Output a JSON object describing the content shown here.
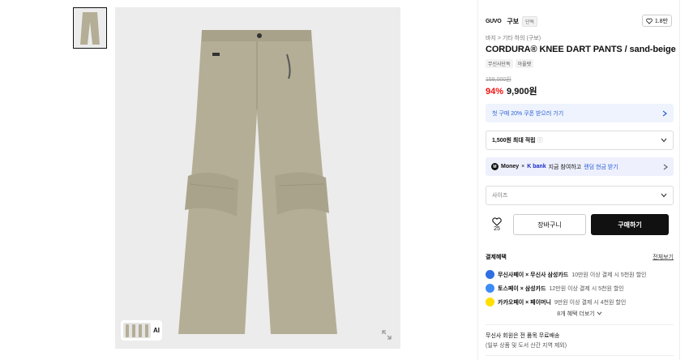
{
  "gallery": {
    "ai_label": "AI"
  },
  "brand": {
    "logo": "GUVO",
    "name": "구보",
    "badge": "단독",
    "likes": "1.8만"
  },
  "product": {
    "breadcrumb": "바지 > 기타 하의 (구보)",
    "title": "CORDURA® KNEE DART PANTS / sand-beige",
    "tags": [
      "무신사단독",
      "아울렛"
    ],
    "original_price": "159,000원",
    "discount": "94%",
    "price": "9,900원"
  },
  "coupon": {
    "label": "첫 구매 20% 쿠폰 받으러 가기"
  },
  "points": {
    "label": "1,500원 최대 적립",
    "info_icon": "ⓘ"
  },
  "money_promo": {
    "money": "Money",
    "x": "×",
    "kbank": "K bank",
    "text": "지금 참여하고",
    "link": "랜덤 현금 받기"
  },
  "size_select": {
    "placeholder": "사이즈"
  },
  "actions": {
    "wish_count": "25",
    "cart_label": "장바구니",
    "buy_label": "구매하기"
  },
  "benefits": {
    "title": "결제혜택",
    "view_all": "전체보기",
    "items": [
      {
        "name": "무신사페이 × 무신사 삼성카드",
        "desc": "10만원 이상 결제 시 5천원 할인",
        "color": "#2f6fe4"
      },
      {
        "name": "토스페이 × 삼성카드",
        "desc": "12만원 이상 결제 시 5천원 할인",
        "color": "#3d8cf5"
      },
      {
        "name": "카카오페이 × 페이머니",
        "desc": "9만원 이상 결제 시 4천원 할인",
        "color": "#ffde00"
      }
    ],
    "more": "8개 혜택 더보기"
  },
  "shipping": {
    "line1": "무신사 회원은 전 품목 무료배송",
    "line2": "(일부 상품 및 도서 산간 지역 제외)"
  },
  "colors": {
    "discount": "#f31110",
    "product": "#b5ae96",
    "accent_blue": "#2c5fd6"
  }
}
